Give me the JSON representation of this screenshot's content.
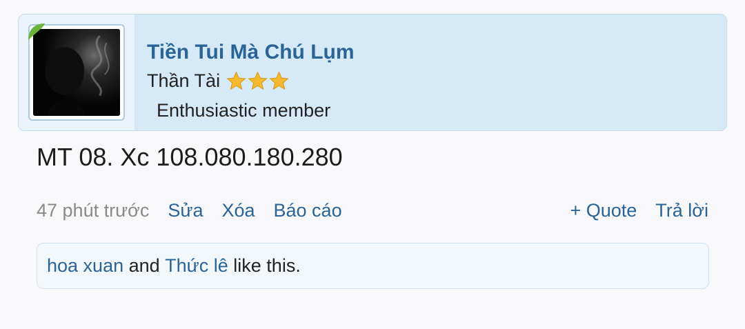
{
  "post": {
    "author": {
      "name": "Tiền Tui Mà Chú Lụm",
      "title": "Thần Tài",
      "star_count": 3,
      "rank": "Enthusiastic member",
      "icons": {
        "avatar": "avatar-photo",
        "badge": "leaf-badge-icon",
        "star": "star-icon"
      },
      "colors": {
        "star": "#f5b82e",
        "badge": "#6bb33c"
      }
    },
    "message": "MT 08. Xc 108.080.180.280",
    "meta": {
      "time": "47 phút trước",
      "edit_label": "Sửa",
      "delete_label": "Xóa",
      "report_label": "Báo cáo",
      "quote_label": "+ Quote",
      "reply_label": "Trả lời"
    },
    "likes": {
      "user1": "hoa xuan",
      "connector": " and ",
      "user2": "Thức lê",
      "suffix": " like this."
    }
  },
  "colors": {
    "link": "#2a6496",
    "header_bg": "#d6e9f7",
    "page_bg": "#f8f8fb"
  }
}
